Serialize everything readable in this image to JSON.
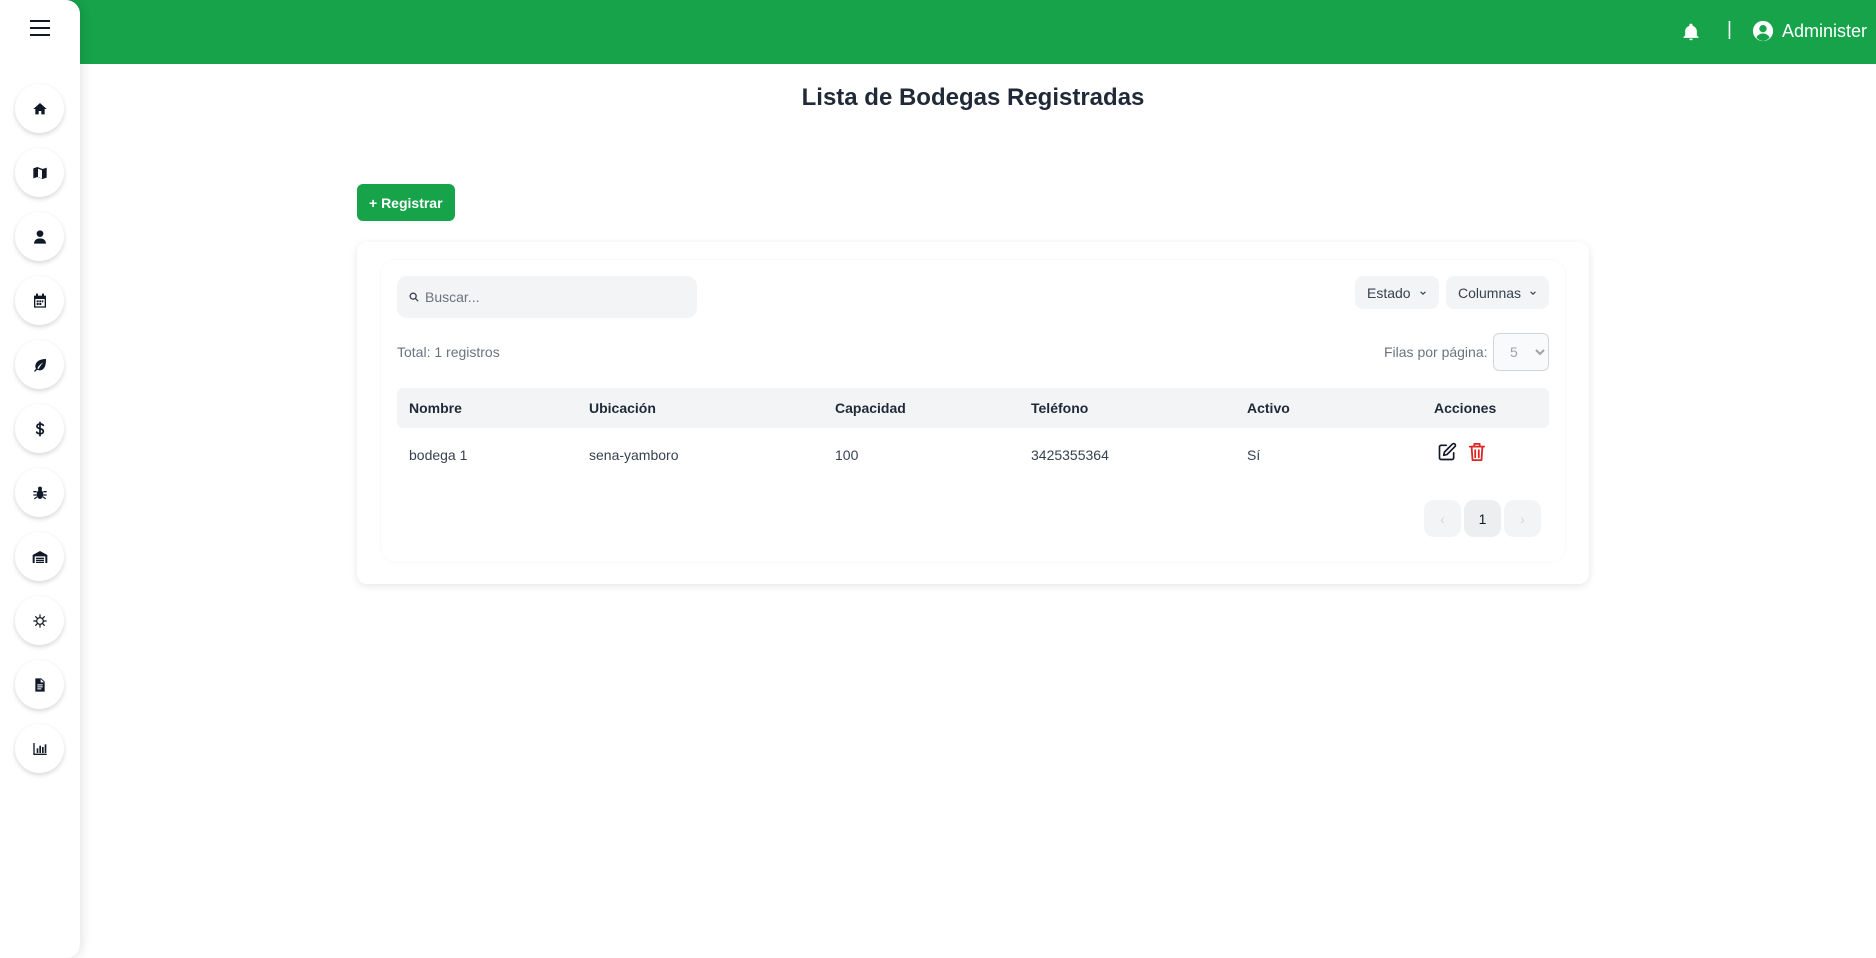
{
  "header": {
    "separator": "|",
    "user_name": "Administer"
  },
  "sidebar": {
    "items": [
      {
        "icon": "home-icon"
      },
      {
        "icon": "map-icon"
      },
      {
        "icon": "user-icon"
      },
      {
        "icon": "calendar-icon"
      },
      {
        "icon": "leaf-icon"
      },
      {
        "icon": "dollar-icon"
      },
      {
        "icon": "bug-icon"
      },
      {
        "icon": "warehouse-icon"
      },
      {
        "icon": "virus-icon"
      },
      {
        "icon": "document-icon"
      },
      {
        "icon": "chart-icon"
      }
    ]
  },
  "page": {
    "title": "Lista de Bodegas Registradas",
    "register_label": "+ Registrar"
  },
  "table_controls": {
    "search_placeholder": "Buscar...",
    "estado_label": "Estado",
    "columnas_label": "Columnas",
    "total_text": "Total: 1 registros",
    "rows_per_page_label": "Filas por página:",
    "rows_per_page_value": "5"
  },
  "table": {
    "headers": [
      "Nombre",
      "Ubicación",
      "Capacidad",
      "Teléfono",
      "Activo",
      "Acciones"
    ],
    "rows": [
      [
        "bodega 1",
        "sena-yamboro",
        "100",
        "3425355364",
        "Sí"
      ]
    ]
  },
  "pagination": {
    "prev": "‹",
    "current": "1",
    "next": "›"
  },
  "colors": {
    "brand": "#16a34a",
    "delete": "#dc2626"
  }
}
